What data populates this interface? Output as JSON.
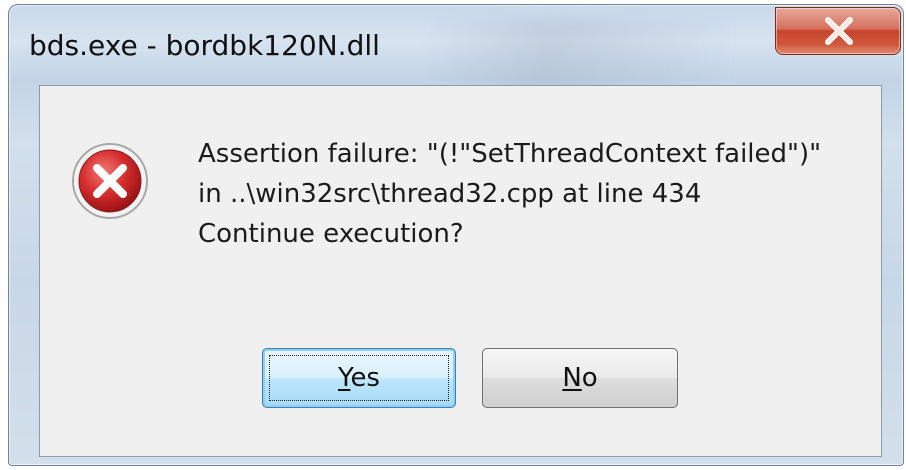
{
  "window": {
    "title": "bds.exe - bordbk120N.dll"
  },
  "close_button": {
    "icon": "close-icon",
    "color": "#c7432b"
  },
  "dialog": {
    "icon": "error-icon",
    "icon_color": "#c8262b",
    "message_lines": [
      "Assertion failure: \"(!\"SetThreadContext failed\")\"",
      "in ..\\win32src\\thread32.cpp at line 434",
      "Continue execution?"
    ]
  },
  "buttons": {
    "yes": {
      "mnemonic": "Y",
      "rest": "es"
    },
    "no": {
      "mnemonic": "N",
      "rest": "o"
    }
  }
}
